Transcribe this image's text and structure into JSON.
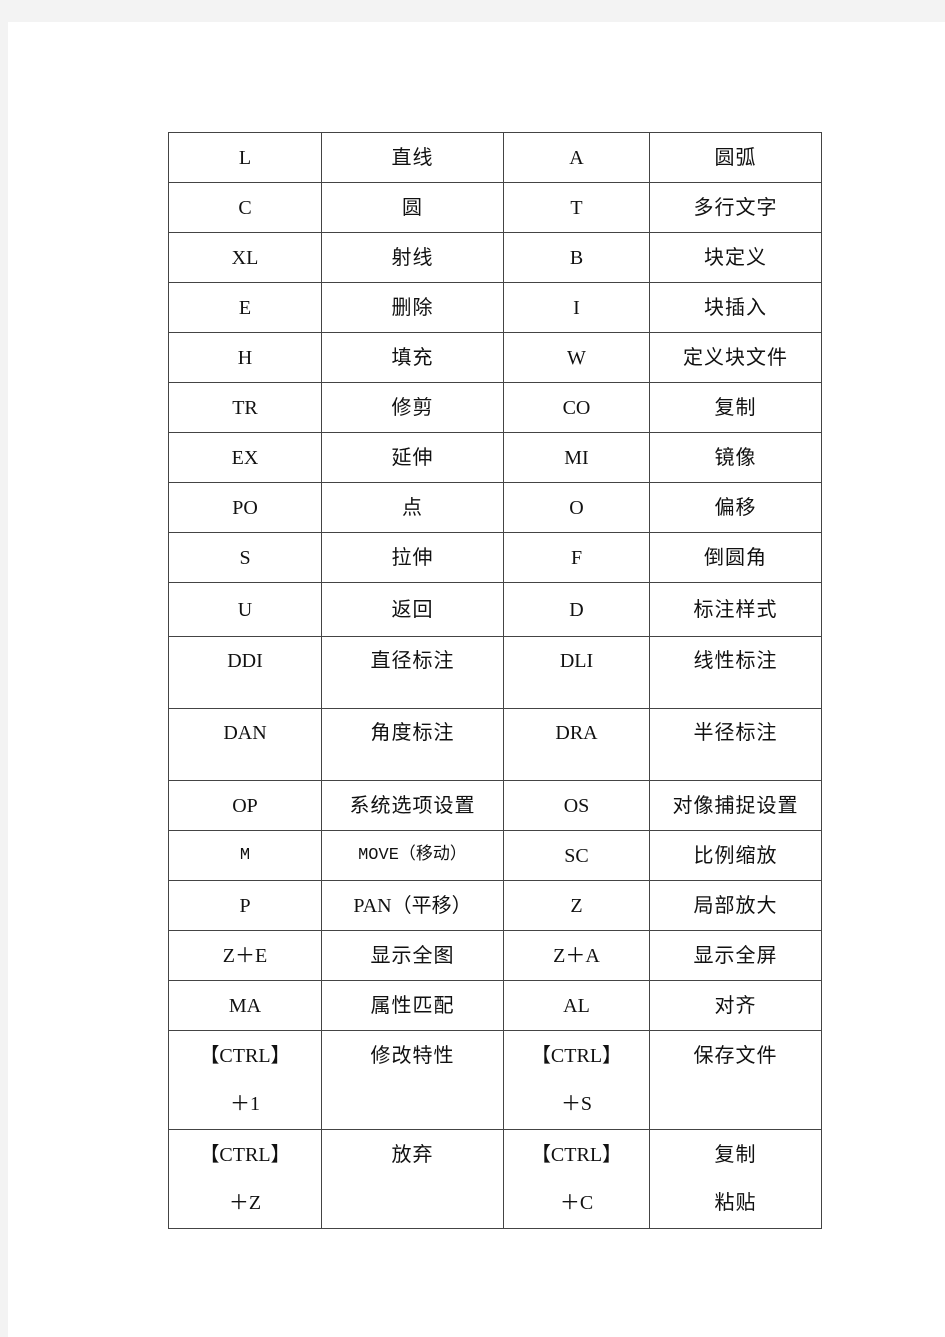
{
  "table": {
    "rows": [
      {
        "cmd1": "L",
        "desc1": "直线",
        "cmd2": "A",
        "desc2": "圆弧"
      },
      {
        "cmd1": "C",
        "desc1": "圆",
        "cmd2": "T",
        "desc2": "多行文字"
      },
      {
        "cmd1": "XL",
        "desc1": "射线",
        "cmd2": "B",
        "desc2": "块定义"
      },
      {
        "cmd1": "E",
        "desc1": "删除",
        "cmd2": "I",
        "desc2": "块插入"
      },
      {
        "cmd1": "H",
        "desc1": "填充",
        "cmd2": "W",
        "desc2": "定义块文件"
      },
      {
        "cmd1": "TR",
        "desc1": "修剪",
        "cmd2": "CO",
        "desc2": "复制"
      },
      {
        "cmd1": "EX",
        "desc1": "延伸",
        "cmd2": "MI",
        "desc2": "镜像"
      },
      {
        "cmd1": "PO",
        "desc1": "点",
        "cmd2": "O",
        "desc2": "偏移"
      },
      {
        "cmd1": "S",
        "desc1": "拉伸",
        "cmd2": "F",
        "desc2": "倒圆角"
      },
      {
        "cmd1": "U",
        "desc1": "返回",
        "cmd2": "D",
        "desc2": "标注样式"
      },
      {
        "cmd1": "DDI",
        "desc1": "直径标注",
        "cmd2": "DLI",
        "desc2": "线性标注"
      },
      {
        "cmd1": "DAN",
        "desc1": "角度标注",
        "cmd2": "DRA",
        "desc2": "半径标注"
      },
      {
        "cmd1": "OP",
        "desc1": "系统选项设置",
        "cmd2": "OS",
        "desc2": "对像捕捉设置"
      },
      {
        "cmd1": "M",
        "desc1": "MOVE（移动）",
        "cmd2": "SC",
        "desc2": "比例缩放"
      },
      {
        "cmd1": "P",
        "desc1": "PAN（平移）",
        "cmd2": "Z",
        "desc2": "局部放大"
      },
      {
        "cmd1": "Z＋E",
        "desc1": "显示全图",
        "cmd2": "Z＋A",
        "desc2": "显示全屏"
      },
      {
        "cmd1": "MA",
        "desc1": "属性匹配",
        "cmd2": "AL",
        "desc2": "对齐"
      },
      {
        "cmd1_l1": "【CTRL】",
        "cmd1_l2": "＋1",
        "desc1": "修改特性",
        "cmd2_l1": "【CTRL】",
        "cmd2_l2": "＋S",
        "desc2": "保存文件"
      },
      {
        "cmd1_l1": "【CTRL】",
        "cmd1_l2": "＋Z",
        "desc1": "放弃",
        "cmd2_l1": "【CTRL】",
        "cmd2_l2": "＋C",
        "desc2_l1": "复制",
        "desc2_l2": "粘贴"
      }
    ]
  }
}
